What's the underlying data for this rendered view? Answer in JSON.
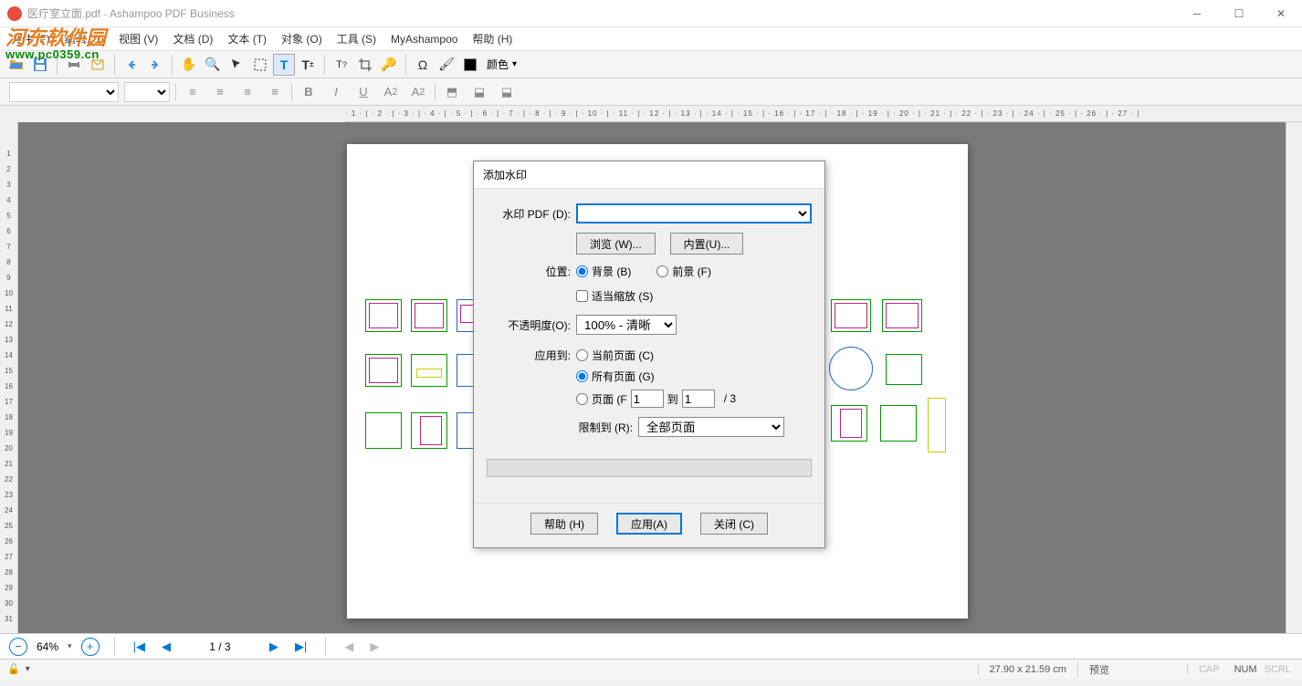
{
  "titlebar": {
    "title": "医疗室立面.pdf - Ashampoo PDF Business"
  },
  "watermark": {
    "line1": "河东软件园",
    "line2": "www.pc0359.cn"
  },
  "menu": {
    "file": "文件 (F)",
    "edit": "编辑 (E)",
    "view": "视图 (V)",
    "file2": "文档 (D)",
    "text": "文本 (T)",
    "object": "对象 (O)",
    "tools": "工具 (S)",
    "myashampoo": "MyAshampoo",
    "help": "帮助 (H)"
  },
  "toolbar": {
    "color_label": "颜色"
  },
  "dialog": {
    "title": "添加水印",
    "pdf_label": "水印 PDF (D):",
    "browse": "浏览 (W)...",
    "builtin": "内置(U)...",
    "position_label": "位置:",
    "background": "背景 (B)",
    "foreground": "前景 (F)",
    "scale": "适当缩放 (S)",
    "opacity_label": "不透明度(O):",
    "opacity_value": "100% - 清晰",
    "apply_to_label": "应用到:",
    "current_page": "当前页面 (C)",
    "all_pages": "所有页面 (G)",
    "page_range": "页面 (F",
    "page_from": "1",
    "to_label": "到",
    "page_to": "1",
    "total": "/ 3",
    "limit_label": "限制到 (R):",
    "limit_value": "全部页面",
    "help": "帮助 (H)",
    "apply": "应用(A)",
    "close": "关闭 (C)"
  },
  "nav": {
    "zoom": "64%",
    "page": "1 / 3"
  },
  "status": {
    "dims": "27.90 x 21.59 cm",
    "preview": "预览",
    "cap": "CAP",
    "num": "NUM",
    "scrl": "SCRL"
  }
}
